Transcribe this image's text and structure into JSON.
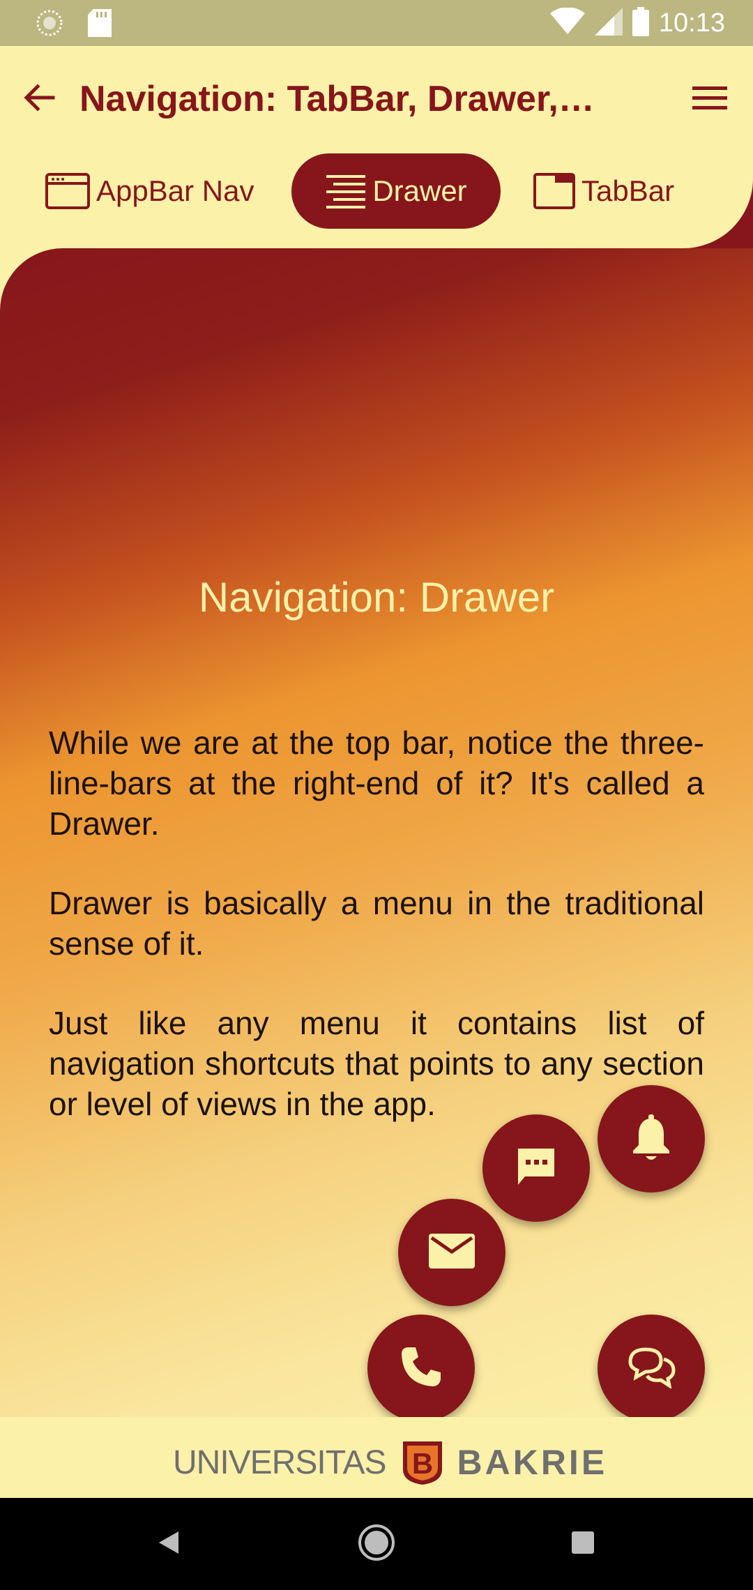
{
  "status_bar": {
    "time": "10:13",
    "icons": [
      "cell-tower-icon",
      "sd-card-icon",
      "wifi-icon",
      "signal-icon",
      "battery-icon"
    ]
  },
  "app_bar": {
    "title": "Navigation: TabBar, Drawer, …",
    "back_icon": "back-arrow-icon",
    "menu_icon": "hamburger-menu-icon"
  },
  "tabs": [
    {
      "label": "AppBar Nav",
      "icon": "browser-window-icon",
      "selected": false
    },
    {
      "label": "Drawer",
      "icon": "drawer-lines-icon",
      "selected": true
    },
    {
      "label": "TabBar Nav",
      "icon": "tab-window-icon",
      "selected": false
    }
  ],
  "content": {
    "title": "Navigation: Drawer",
    "paragraphs": [
      "While we are at the top bar, notice the three-line-bars at the right-end of it? It's called a Drawer.",
      "Drawer is basically a menu in the traditional sense of it.",
      "Just like any menu it contains list of navigation shortcuts that points to any section or level of views in the app."
    ]
  },
  "fabs": [
    {
      "name": "notifications",
      "icon": "bell-icon"
    },
    {
      "name": "sms",
      "icon": "sms-icon"
    },
    {
      "name": "email",
      "icon": "mail-icon"
    },
    {
      "name": "phone",
      "icon": "phone-icon"
    },
    {
      "name": "forum",
      "icon": "chat-bubbles-icon"
    }
  ],
  "footer": {
    "logo_left": "UNIVERSITAS",
    "logo_right": "BAKRIE",
    "logo_mark": "B"
  },
  "nav_bar": {
    "icons": [
      "nav-back-icon",
      "nav-home-icon",
      "nav-recent-icon"
    ]
  },
  "colors": {
    "primary": "#86161B",
    "background": "#FCF1A9",
    "accent": "#EC9530",
    "status_bar": "#BCB680"
  }
}
